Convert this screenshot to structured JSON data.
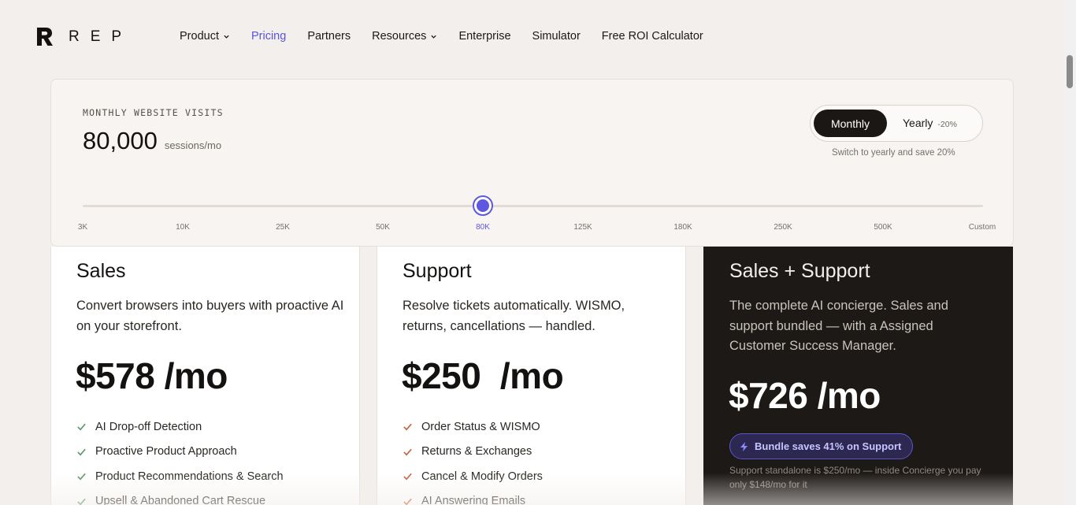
{
  "brand": {
    "name": "REP"
  },
  "nav": {
    "items": [
      {
        "label": "Product",
        "has_dropdown": true,
        "active": false
      },
      {
        "label": "Pricing",
        "has_dropdown": false,
        "active": true
      },
      {
        "label": "Partners",
        "has_dropdown": false,
        "active": false
      },
      {
        "label": "Resources",
        "has_dropdown": true,
        "active": false
      },
      {
        "label": "Enterprise",
        "has_dropdown": false,
        "active": false
      },
      {
        "label": "Simulator",
        "has_dropdown": false,
        "active": false
      },
      {
        "label": "Free ROI Calculator",
        "has_dropdown": false,
        "active": false
      }
    ]
  },
  "calculator": {
    "label": "MONTHLY WEBSITE VISITS",
    "value": "80,000",
    "unit": "sessions/mo",
    "billing": {
      "monthly_label": "Monthly",
      "yearly_label": "Yearly",
      "yearly_discount": "-20%",
      "selected": "Monthly",
      "note": "Switch to yearly and save 20%"
    },
    "slider": {
      "ticks": [
        "3K",
        "10K",
        "25K",
        "50K",
        "80K",
        "125K",
        "180K",
        "250K",
        "500K",
        "Custom"
      ],
      "selected_tick": "80K",
      "selected_index": 4
    }
  },
  "plans": {
    "sales": {
      "title": "Sales",
      "description": "Convert browsers into buyers with proactive AI on your storefront.",
      "price": "$578 /mo",
      "features": [
        "AI Drop-off Detection",
        "Proactive Product Approach",
        "Product Recommendations & Search",
        "Upsell & Abandoned Cart Rescue"
      ]
    },
    "support": {
      "title": "Support",
      "description": "Resolve tickets automatically. WISMO, returns, cancellations — handled.",
      "price": "$250  /mo",
      "features": [
        "Order Status & WISMO",
        "Returns & Exchanges",
        "Cancel & Modify Orders",
        "AI Answering Emails"
      ]
    },
    "bundle": {
      "title": "Sales + Support",
      "description": "The complete AI concierge. Sales and support bundled — with a Assigned Customer Success Manager.",
      "price": "$726 /mo",
      "badge": "Bundle saves 41% on Support",
      "note": "Support standalone is $250/mo — inside Concierge you pay only $148/mo for it"
    }
  },
  "colors": {
    "accent": "#5e58e0",
    "page_bg": "#f3efec",
    "dark_card": "#1c1916",
    "check_sales": "#5a9a6b",
    "check_support": "#c8623f"
  },
  "icons": {
    "check": "check-icon",
    "chevron": "chevron-down-icon",
    "bolt": "bolt-icon"
  }
}
